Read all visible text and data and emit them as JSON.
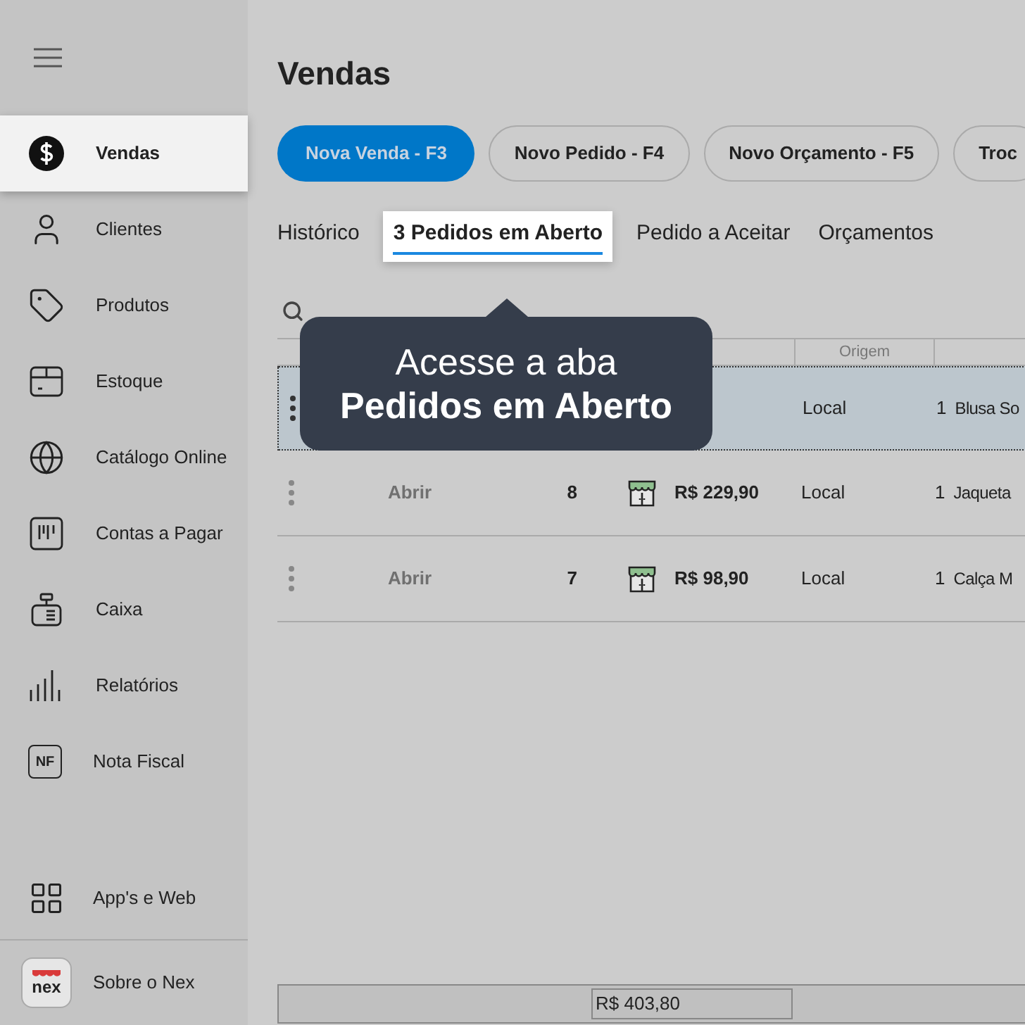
{
  "sidebar": {
    "items": [
      {
        "label": "Vendas",
        "selected": true
      },
      {
        "label": "Clientes",
        "selected": false
      },
      {
        "label": "Produtos",
        "selected": false
      },
      {
        "label": "Estoque",
        "selected": false
      },
      {
        "label": "Catálogo Online",
        "selected": false
      },
      {
        "label": "Contas a Pagar",
        "selected": false
      },
      {
        "label": "Caixa",
        "selected": false
      },
      {
        "label": "Relatórios",
        "selected": false
      },
      {
        "label": "Nota Fiscal",
        "icon_text": "NF",
        "selected": false
      }
    ],
    "bottom_items": [
      {
        "label": "App's e Web"
      },
      {
        "label": "Sobre o Nex",
        "logo_text": "nex"
      }
    ]
  },
  "title": "Vendas",
  "actions": [
    {
      "label": "Nova Venda - F3",
      "primary": true
    },
    {
      "label": "Novo Pedido - F4",
      "primary": false
    },
    {
      "label": "Novo Orçamento - F5",
      "primary": false
    },
    {
      "label": "Troc",
      "primary": false
    }
  ],
  "tabs": [
    {
      "label": "Histórico",
      "selected": false
    },
    {
      "label": "3 Pedidos em Aberto",
      "selected": true
    },
    {
      "label": "Pedido a Aceitar",
      "selected": false
    },
    {
      "label": "Orçamentos",
      "selected": false
    }
  ],
  "tooltip": "Acesse a aba\n**Pedidos em Aberto**",
  "table": {
    "columns": [
      {
        "label": "Origem"
      }
    ],
    "rows": [
      {
        "selected": true,
        "open": null,
        "number": null,
        "total": null,
        "origin": "Local",
        "qty": "1",
        "product": "Blusa So"
      },
      {
        "selected": false,
        "open": "Abrir",
        "number": "8",
        "total": "R$ 229,90",
        "origin": "Local",
        "qty": "1",
        "product": "Jaqueta"
      },
      {
        "selected": false,
        "open": "Abrir",
        "number": "7",
        "total": "R$ 98,90",
        "origin": "Local",
        "qty": "1",
        "product": "Calça M"
      }
    ]
  },
  "footer": {
    "total": "R$ 403,80"
  }
}
